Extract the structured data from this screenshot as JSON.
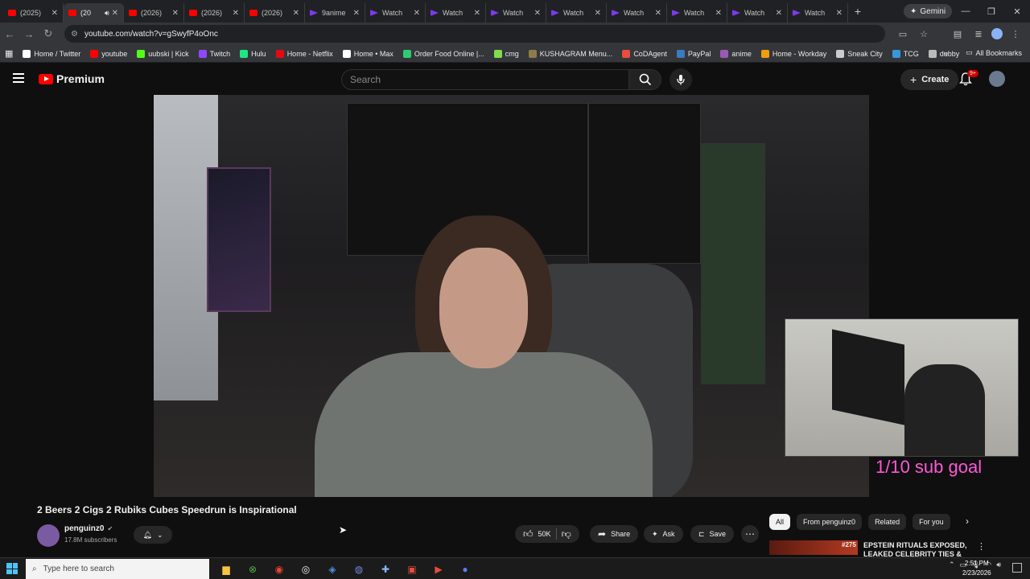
{
  "browser": {
    "tabs": [
      {
        "label": "(2025)",
        "favicon": "youtube-icon",
        "active": false
      },
      {
        "label": "(20",
        "favicon": "youtube-icon",
        "active": true
      },
      {
        "label": "(2026)",
        "favicon": "youtube-icon",
        "active": false
      },
      {
        "label": "(2026)",
        "favicon": "youtube-icon",
        "active": false
      },
      {
        "label": "(2026)",
        "favicon": "youtube-icon",
        "active": false
      },
      {
        "label": "9anime",
        "favicon": "play-icon",
        "active": false
      },
      {
        "label": "Watch",
        "favicon": "play-icon",
        "active": false
      },
      {
        "label": "Watch",
        "favicon": "play-icon",
        "active": false
      },
      {
        "label": "Watch",
        "favicon": "play-icon",
        "active": false
      },
      {
        "label": "Watch",
        "favicon": "play-icon",
        "active": false
      },
      {
        "label": "Watch",
        "favicon": "play-icon",
        "active": false
      },
      {
        "label": "Watch",
        "favicon": "play-icon",
        "active": false
      },
      {
        "label": "Watch",
        "favicon": "play-icon",
        "active": false
      },
      {
        "label": "Watch",
        "favicon": "play-icon",
        "active": false
      }
    ],
    "gemini_label": "Gemini",
    "url": "youtube.com/watch?v=gSwyfP4oOnc",
    "bookmarks": [
      {
        "label": "Home / Twitter",
        "color": "#ffffff"
      },
      {
        "label": "youtube",
        "color": "#ff0000"
      },
      {
        "label": "uubski | Kick",
        "color": "#53fc18"
      },
      {
        "label": "Twitch",
        "color": "#9146ff"
      },
      {
        "label": "Hulu",
        "color": "#1ce783"
      },
      {
        "label": "Home - Netflix",
        "color": "#e50914"
      },
      {
        "label": "Home • Max",
        "color": "#ffffff"
      },
      {
        "label": "Order Food Online |...",
        "color": "#2ecc71"
      },
      {
        "label": "cmg",
        "color": "#7fdc4f"
      },
      {
        "label": "KUSHAGRAM Menu...",
        "color": "#8d7c4a"
      },
      {
        "label": "CoDAgent",
        "color": "#e74c3c"
      },
      {
        "label": "PayPal",
        "color": "#3b7bbf"
      },
      {
        "label": "anime",
        "color": "#9b59b6"
      },
      {
        "label": "Home - Workday",
        "color": "#f39c12"
      },
      {
        "label": "Sneak City",
        "color": "#cccccc"
      },
      {
        "label": "TCG",
        "color": "#3498db"
      },
      {
        "label": "dubby",
        "color": "#bbbbbb"
      }
    ],
    "all_bookmarks": "All Bookmarks"
  },
  "youtube": {
    "logo_text": "Premium",
    "search_placeholder": "Search",
    "create_label": "Create",
    "notification_badge": "9+",
    "video": {
      "title": "2 Beers 2 Cigs 2 Rubiks Cubes Speedrun is Inspirational",
      "overlay_text": "1/10 sub goal",
      "channel_name": "penguinz0",
      "subscribers": "17.8M subscribers",
      "likes": "50K",
      "share": "Share",
      "ask": "Ask",
      "save": "Save"
    },
    "chips": [
      "All",
      "From penguinz0",
      "Related",
      "For you"
    ],
    "recommendation": {
      "badge": "#275",
      "title": "EPSTEIN RITUALS EXPOSED, LEAKED CELEBRITY TIES & TH..."
    }
  },
  "taskbar": {
    "search_placeholder": "Type here to search",
    "time": "2:51 PM",
    "date": "2/23/2026"
  },
  "colors": {
    "yt_red": "#ff0000",
    "overlay_pink": "#ff57d8",
    "bg": "#0f0f0f"
  }
}
